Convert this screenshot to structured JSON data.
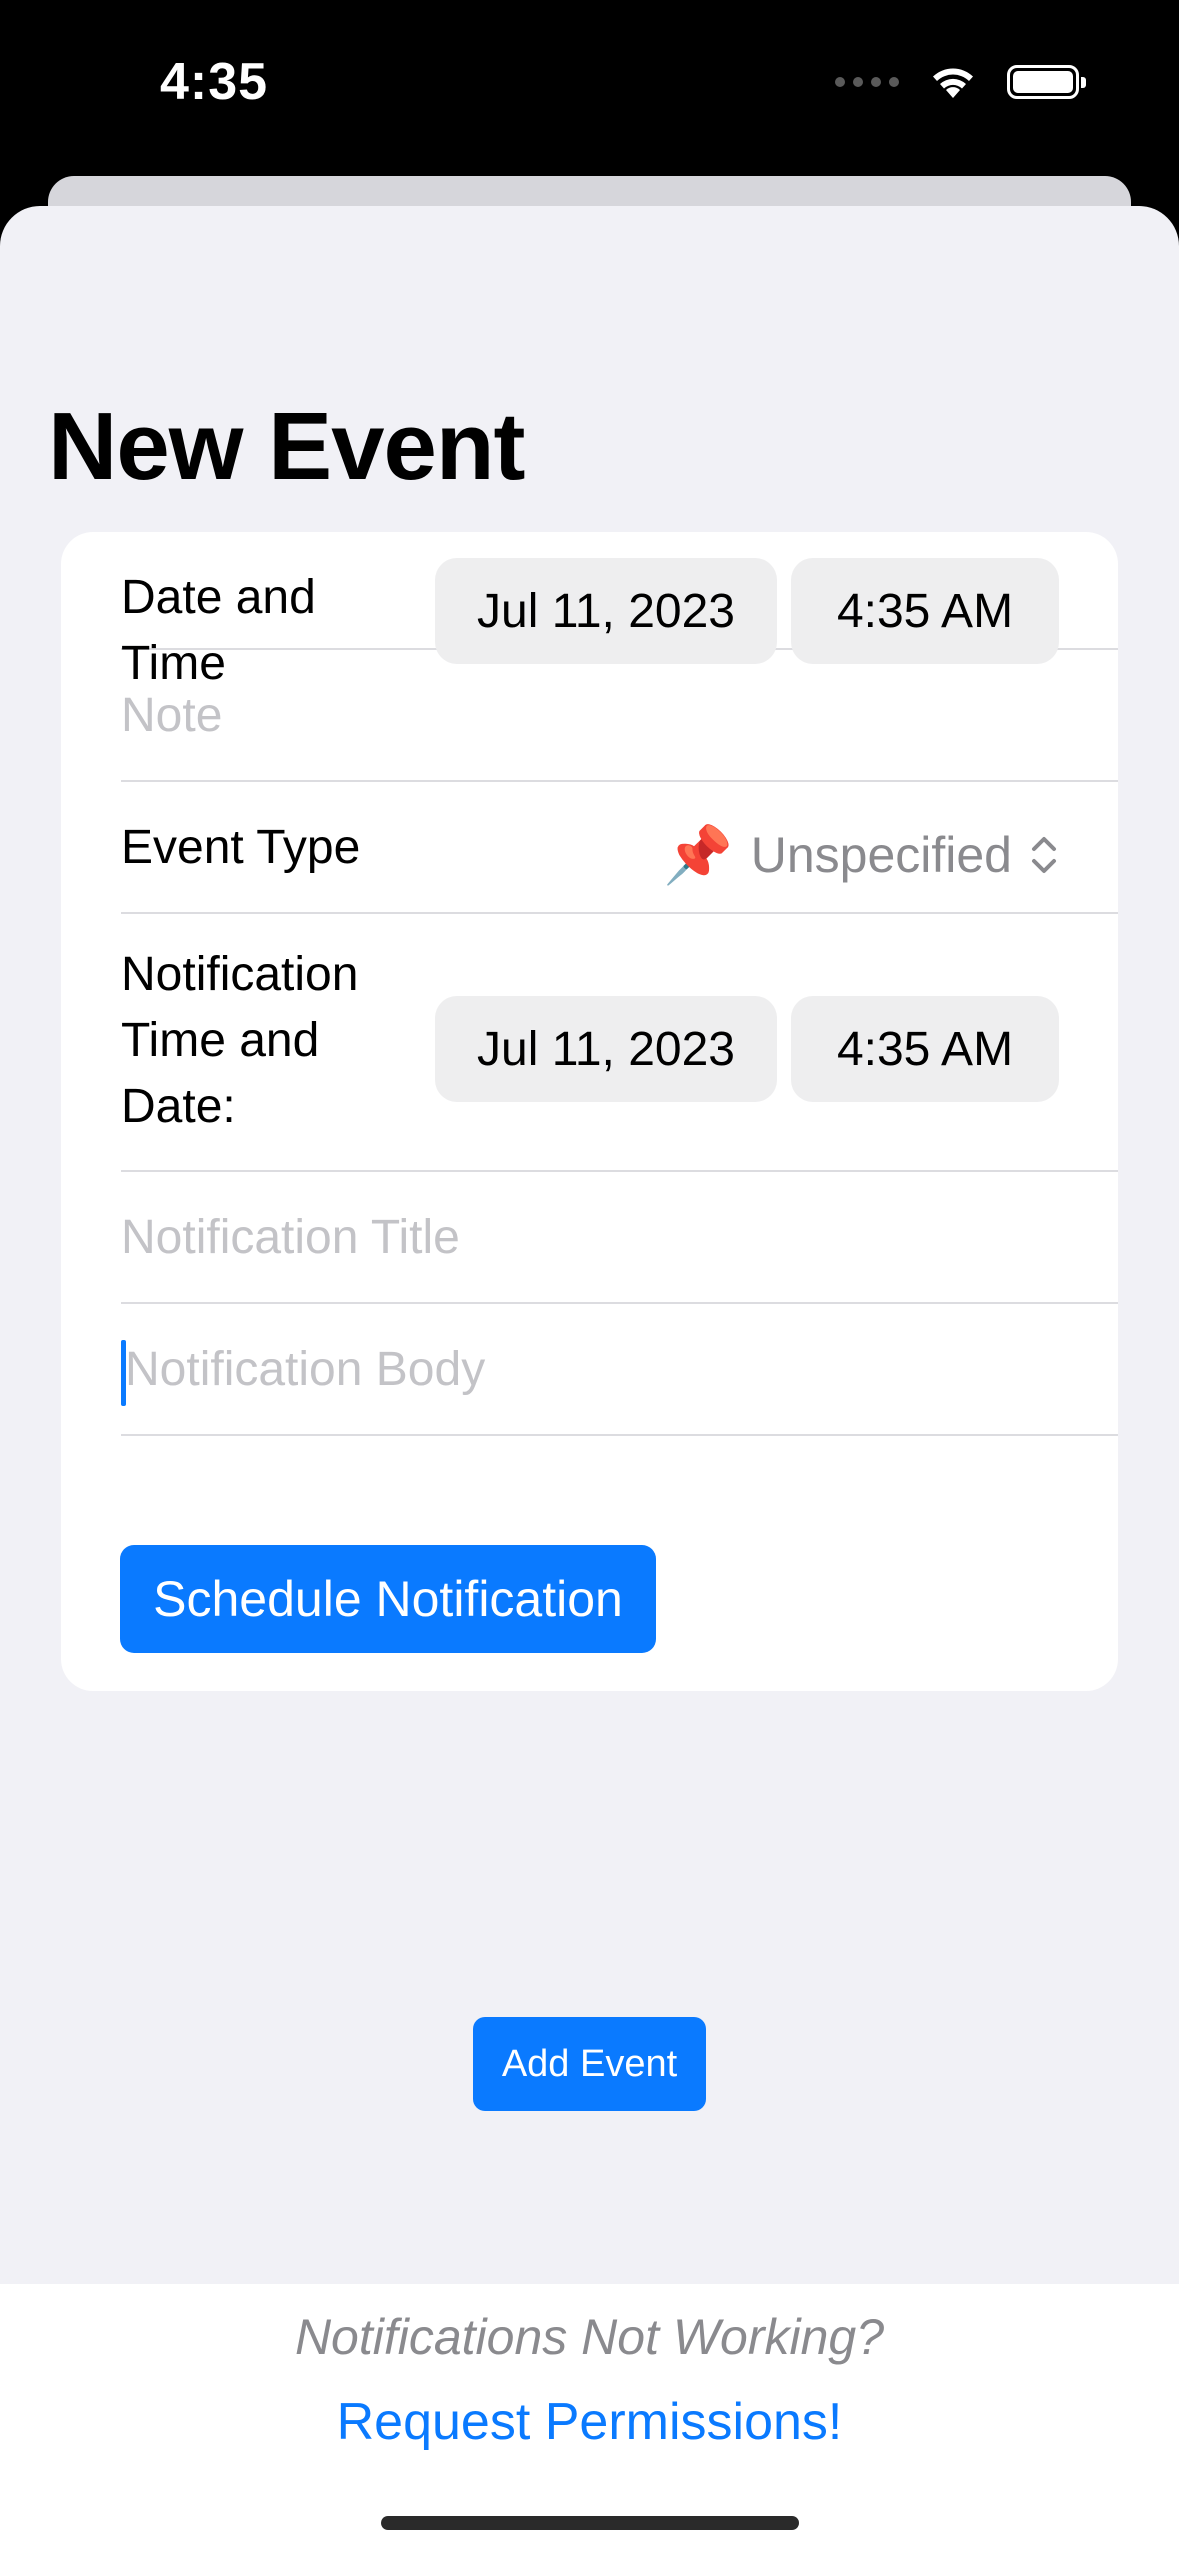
{
  "status_bar": {
    "time": "4:35"
  },
  "page": {
    "title": "New Event"
  },
  "form": {
    "date_time": {
      "label": "Date and Time",
      "date": "Jul 11, 2023",
      "time": "4:35 AM"
    },
    "note": {
      "placeholder": "Note"
    },
    "event_type": {
      "label": "Event Type",
      "icon": "pushpin-icon",
      "value": "Unspecified"
    },
    "notification_datetime": {
      "label": "Notification Time and Date:",
      "date": "Jul 11, 2023",
      "time": "4:35 AM"
    },
    "notification_title": {
      "placeholder": "Notification Title"
    },
    "notification_body": {
      "placeholder": "Notification Body"
    },
    "schedule_button": "Schedule Notification"
  },
  "add_event_button": "Add Event",
  "footer": {
    "note": "Notifications Not Working?",
    "link": "Request Permissions!"
  },
  "colors": {
    "accent": "#0A7AFF",
    "sheet_background": "#F1F1F6",
    "placeholder": "#C3C3C7",
    "secondary_text": "#8A8A8E"
  }
}
